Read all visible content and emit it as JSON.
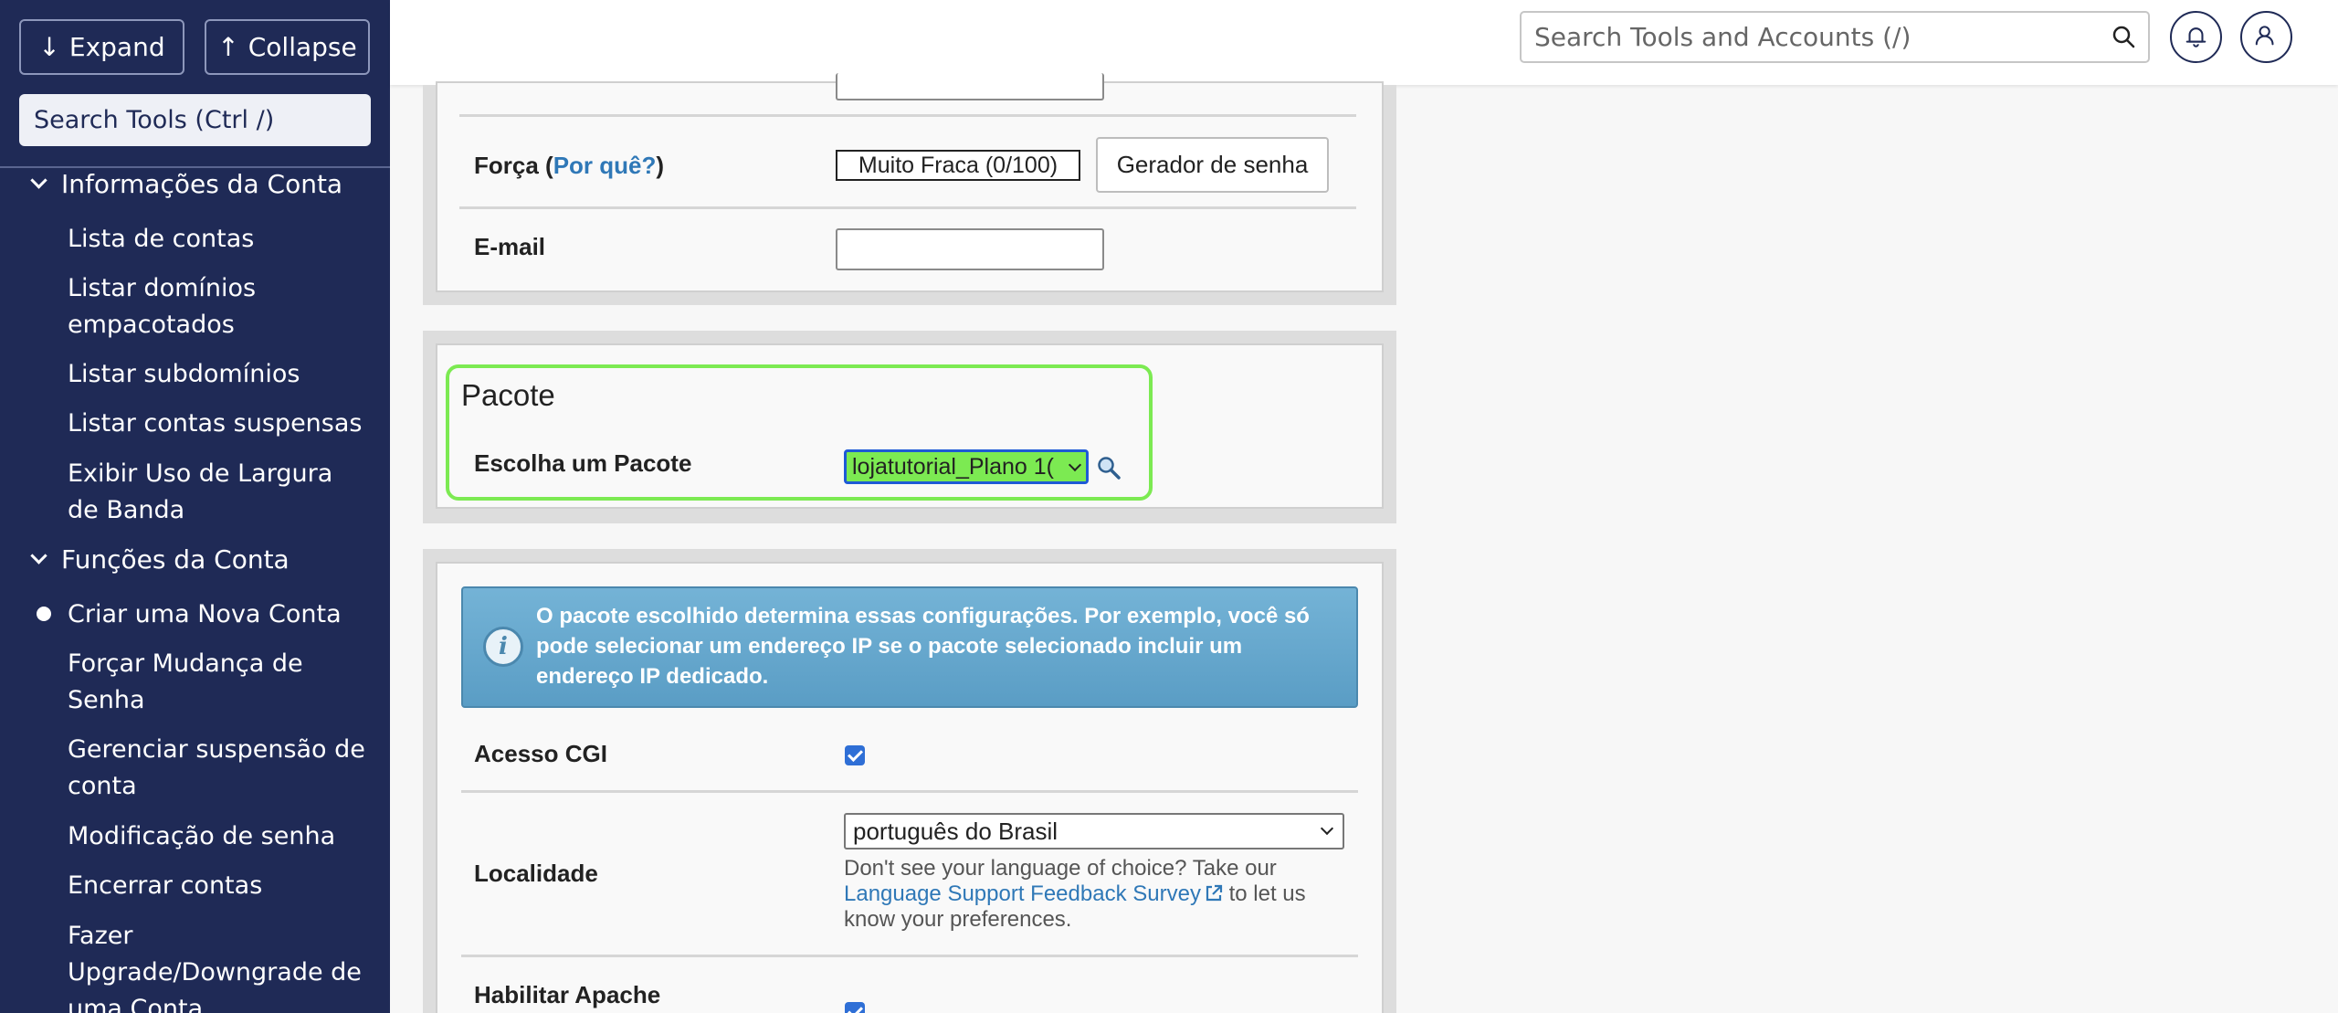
{
  "sidebar": {
    "expand_label": "Expand",
    "collapse_label": "Collapse",
    "search_placeholder": "Search Tools (Ctrl /)",
    "sections": [
      {
        "label": "Informações da Conta",
        "items": [
          "Lista de contas",
          "Listar domínios empacotados",
          "Listar subdomínios",
          "Listar contas suspensas",
          "Exibir Uso de Largura de Banda"
        ]
      },
      {
        "label": "Funções da Conta",
        "items": [
          "Criar uma Nova Conta",
          "Forçar Mudança de Senha",
          "Gerenciar suspensão de conta",
          "Modificação de senha",
          "Encerrar contas",
          "Fazer Upgrade/Downgrade de uma Conta"
        ],
        "active_item": "Criar uma Nova Conta"
      }
    ]
  },
  "topbar": {
    "search_placeholder": "Search Tools and Accounts (/)",
    "icons": [
      "search-icon",
      "bell-icon",
      "user-icon"
    ]
  },
  "form": {
    "strength_label_prefix": "Força (",
    "strength_link": "Por quê?",
    "strength_label_suffix": ")",
    "strength_value": "Muito Fraca (0/100)",
    "password_generator_label": "Gerador de senha",
    "email_label": "E-mail",
    "email_value": ""
  },
  "package": {
    "title": "Pacote",
    "choose_label": "Escolha um Pacote",
    "selected_value": "lojatutorial_Plano 1("
  },
  "settings": {
    "info_text": "O pacote escolhido determina essas configurações. Por exemplo, você só pode selecionar um endereço IP se o pacote selecionado incluir um endereço IP dedicado.",
    "cgi_label": "Acesso CGI",
    "cgi_checked": true,
    "locale_label": "Localidade",
    "locale_value": "português do Brasil",
    "locale_help_before": "Don't see your language of choice? Take our",
    "locale_help_link": "Language Support Feedback Survey",
    "locale_help_after": "to let us know your preferences.",
    "apache_label": "Habilitar Apache",
    "apache_checked": true
  },
  "colors": {
    "sidebar_bg": "#1f2a56",
    "highlight_green": "#7cea52",
    "info_blue": "#5a9dc5",
    "link_blue": "#2f78b7"
  }
}
